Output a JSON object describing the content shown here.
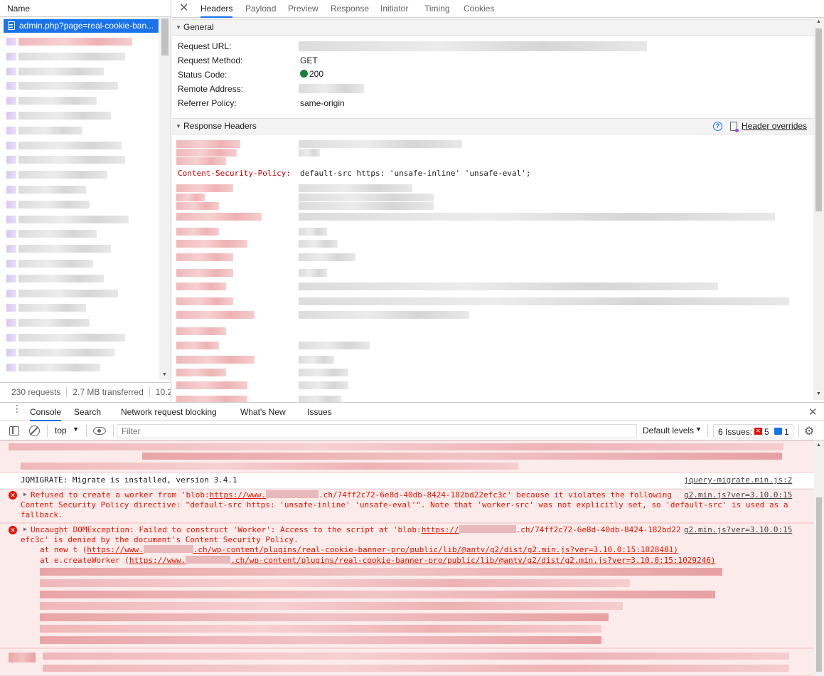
{
  "network": {
    "name_header": "Name",
    "selected_request": "admin.php?page=real-cookie-ban...",
    "footer": {
      "requests": "230 requests",
      "transferred": "2.7 MB transferred",
      "resources": "10.2"
    }
  },
  "details": {
    "tabs": [
      "Headers",
      "Payload",
      "Preview",
      "Response",
      "Initiator",
      "Timing",
      "Cookies"
    ],
    "active_tab": "Headers",
    "general": {
      "title": "General",
      "rows": [
        {
          "key": "Request URL:",
          "value": ""
        },
        {
          "key": "Request Method:",
          "value": "GET"
        },
        {
          "key": "Status Code:",
          "value": "200"
        },
        {
          "key": "Remote Address:",
          "value": ""
        },
        {
          "key": "Referrer Policy:",
          "value": "same-origin"
        }
      ]
    },
    "response_headers": {
      "title": "Response Headers",
      "overrides_label": "Header overrides",
      "csp_key": "Content-Security-Policy:",
      "csp_value": "default-src https: 'unsafe-inline' 'unsafe-eval';"
    }
  },
  "drawer": {
    "tabs": [
      "Console",
      "Search",
      "Network request blocking",
      "What's New",
      "Issues"
    ],
    "active_tab": "Console",
    "context": "top",
    "filter_placeholder": "Filter",
    "levels": "Default levels",
    "issues": {
      "label": "6 Issues:",
      "errors": "5",
      "info": "1"
    }
  },
  "console": {
    "jqmigrate": {
      "text": "JQMIGRATE: Migrate is installed, version 3.4.1",
      "source": "jquery-migrate.min.js:2"
    },
    "error1": {
      "line1_a": "Refused to create a worker from 'blob:",
      "line1_link": "https://www.",
      "line1_b": ".ch/74ff2c72-6e8d-40db-8424-182bd22efc3c' because it violates the following",
      "line2": "Content Security Policy directive: \"default-src https: 'unsafe-inline' 'unsafe-eval'\". Note that 'worker-src' was not explicitly set, so 'default-src' is used as a",
      "line3": "fallback.",
      "source": "g2.min.js?ver=3.10.0:15"
    },
    "error2": {
      "line1_a": "Uncaught DOMException: Failed to construct 'Worker': Access to the script at 'blob:",
      "line1_link": "https://",
      "line1_b": ".ch/74ff2c72-6e8d-40db-8424-182bd22",
      "line2": "efc3c' is denied by the document's Content Security Policy.",
      "stack1_a": "at new t (",
      "stack1_link": "https://www.",
      "stack1_b": ".ch/wp-content/plugins/real-cookie-banner-pro/public/lib/@antv/g2/dist/g2.min.js?ver=3.10.0:15:1028481)",
      "stack2_a": "at e.createWorker (",
      "stack2_link": "https://www.",
      "stack2_b": ".ch/wp-content/plugins/real-cookie-banner-pro/public/lib/@antv/g2/dist/g2.min.js?ver=3.10.0:15:1029246)",
      "source": "g2.min.js?ver=3.10.0:15"
    }
  }
}
